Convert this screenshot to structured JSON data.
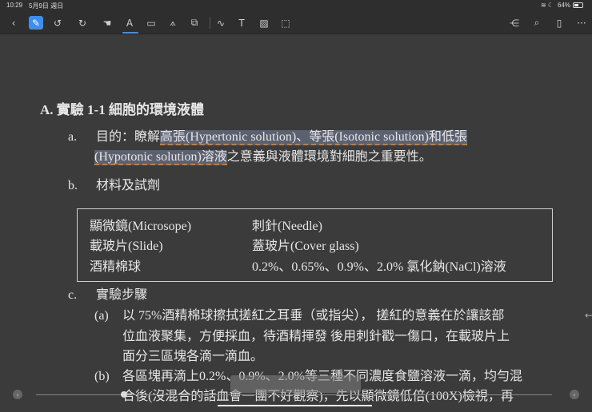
{
  "status": {
    "time": "10:29",
    "date": "5月9日 週日",
    "battery": "64%"
  },
  "toolbar": {
    "left": [
      {
        "n": "back-icon",
        "g": "‹"
      },
      {
        "n": "pen-icon",
        "g": "✎"
      },
      {
        "n": "undo-icon",
        "g": "↺"
      },
      {
        "n": "redo-icon",
        "g": "↻"
      },
      {
        "n": "hand-icon",
        "g": "☚"
      },
      {
        "n": "text-highlighter-icon",
        "g": "A"
      },
      {
        "n": "rectangle-select-icon",
        "g": "▭"
      },
      {
        "n": "lasso-icon",
        "g": "⟑"
      },
      {
        "n": "sticker-icon",
        "g": "⧉"
      },
      {
        "n": "shape-icon",
        "g": "∿"
      },
      {
        "n": "textbox-icon",
        "g": "T"
      },
      {
        "n": "image-icon",
        "g": "▨"
      },
      {
        "n": "scan-icon",
        "g": "⬚"
      }
    ],
    "right": [
      {
        "n": "share-icon",
        "g": "⋲"
      },
      {
        "n": "search-icon",
        "g": "⌕"
      },
      {
        "n": "bookmark-icon",
        "g": "▯"
      },
      {
        "n": "more-icon",
        "g": "···"
      }
    ]
  },
  "doc": {
    "heading": "A. 實驗 1-1  細胞的環境液體",
    "a_label": "a.",
    "a_pre": "目的：瞭解",
    "a_hl1": "高張(Hypertonic solution)、等張(Isotonic solution)和低張",
    "a_hl2": "(Hypotonic solution)溶液",
    "a_post": "之意義與液體環境對細胞之重要性。",
    "b_label": "b.",
    "b_text": "材料及試劑",
    "materials": [
      [
        "顯微鏡(Microsope)",
        "刺針(Needle)"
      ],
      [
        "載玻片(Slide)",
        "蓋玻片(Cover glass)"
      ],
      [
        "酒精棉球",
        "0.2%、0.65%、0.9%、2.0%  氯化鈉(NaCl)溶液"
      ]
    ],
    "c_label": "c.",
    "c_text": "實驗步驟",
    "step_a_label": "(a)",
    "step_a_lines": [
      "以 75%酒精棉球擦拭搓紅之耳垂（或指尖）， 搓紅的意義在於讓該部",
      "位血液聚集，方便採血，待酒精揮發 後用刺針戳一傷口，在載玻片上",
      "面分三區塊各滴一滴血。"
    ],
    "step_b_label": "(b)",
    "step_b_lines": [
      "各區塊再滴上0.2%、0.9%、2.0%等三種不同濃度食鹽溶液一滴，均勻混",
      "合後(沒混合的話血會一團不好觀察)，先以顯微鏡低倍(100X)檢視，再"
    ]
  },
  "nav": {
    "prev": "‹",
    "next": "›",
    "side_arrow": "←"
  }
}
